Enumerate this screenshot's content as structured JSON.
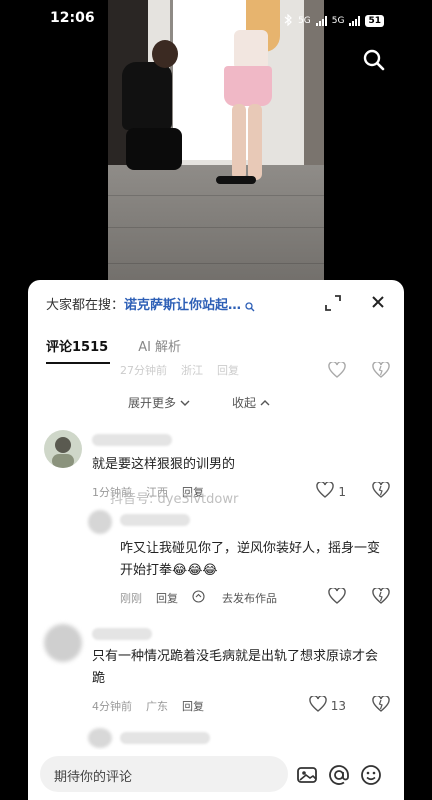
{
  "status_bar": {
    "time": "12:06",
    "signal_1": "5G",
    "signal_2": "5G",
    "battery": "51"
  },
  "comments_panel": {
    "search_prefix": "大家都在搜：",
    "search_query": "诺克萨斯让你站起…",
    "tab_comments": "评论1515",
    "tab_ai": "AI 解析",
    "faded_meta": {
      "time": "27分钟前",
      "location": "浙江",
      "reply": "回复"
    },
    "expand_more": "展开更多",
    "collapse": "收起"
  },
  "comments": [
    {
      "text": "就是要这样狠狠的训男的",
      "time": "1分钟前",
      "location": "江西",
      "reply": "回复",
      "likes": "1"
    },
    {
      "text": "咋又让我碰见你了，逆风你装好人，摇身一变开始打拳😂😂😂",
      "time": "刚刚",
      "reply": "回复",
      "share": "去发布作品"
    },
    {
      "text": "只有一种情况跪着没毛病就是出轨了想求原谅才会跪",
      "time": "4分钟前",
      "location": "广东",
      "reply": "回复",
      "likes": "13"
    }
  ],
  "input": {
    "placeholder": "期待你的评论"
  },
  "watermark": "抖音号: dye3lvtdowr",
  "icons": {
    "search": "search-icon",
    "expand": "expand-icon",
    "close": "close-icon",
    "heart": "heart-icon",
    "dislike": "broken-heart-icon",
    "image": "image-icon",
    "mention": "at-icon",
    "emoji": "emoji-icon"
  }
}
